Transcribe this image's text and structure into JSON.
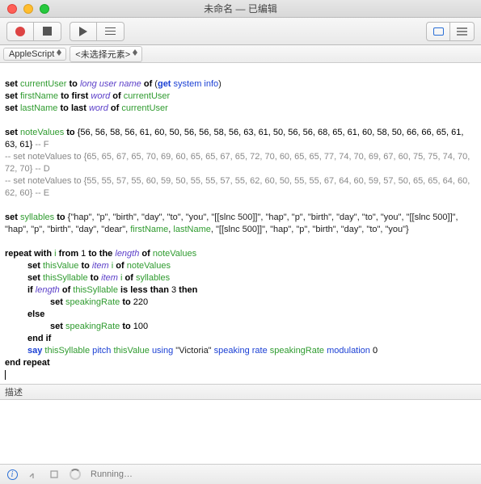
{
  "window": {
    "title": "未命名 — 已编辑"
  },
  "subbar": {
    "language": "AppleScript",
    "nav": "<未选择元素>"
  },
  "code": {
    "l1_set": "set",
    "l1_var": "currentUser",
    "l1_to": "to",
    "l1_prop": "long user name",
    "l1_of": "of",
    "l1_paren_o": "(",
    "l1_call": "get",
    "l1_arg": "system info",
    "l1_paren_c": ")",
    "l2_set": "set",
    "l2_var": "firstName",
    "l2_to": "to",
    "l2_first": "first",
    "l2_word": "word",
    "l2_of": "of",
    "l2_cu": "currentUser",
    "l3_set": "set",
    "l3_var": "lastName",
    "l3_to": "to",
    "l3_last": "last",
    "l3_word": "word",
    "l3_of": "of",
    "l3_cu": "currentUser",
    "nv_set": "set",
    "nv_var": "noteValues",
    "nv_to": "to",
    "nv_list": "{56, 56, 58, 56, 61, 60, 50, 56, 56, 58, 56, 63, 61, 50, 56, 56, 68, 65, 61, 60, 58, 50, 66, 66, 65, 61, 63, 61}",
    "nv_cmt": " -- F",
    "nvD_cmt": "-- set noteValues to {65, 65, 67, 65, 70, 69, 60, 65, 65, 67, 65, 72, 70, 60, 65, 65, 77, 74, 70, 69, 67, 60, 75, 75, 74, 70, 72, 70} -- D",
    "nvE_cmt": "-- set noteValues to {55, 55, 57, 55, 60, 59, 50, 55, 55, 57, 55, 62, 60, 50, 55, 55, 67, 64, 60, 59, 57, 50, 65, 65, 64, 60, 62, 60} -- E",
    "sy_set": "set",
    "sy_var": "syllables",
    "sy_to": "to",
    "sy_p1": "{\"hap\", \"p\", \"birth\", \"day\", \"to\", \"you\", \"[[slnc 500]]\", \"hap\", \"p\", \"birth\", \"day\", \"to\", \"you\", \"[[slnc 500]]\", \"hap\", \"p\", \"birth\", \"day\", \"dear\", ",
    "sy_fn": "firstName",
    "sy_comma1": ", ",
    "sy_ln": "lastName",
    "sy_p2": ", \"[[slnc 500]]\", \"hap\", \"p\", \"birth\", \"day\", \"to\", \"you\"}",
    "rp_repeat": "repeat with",
    "rp_i": "i",
    "rp_from": "from",
    "rp_1": "1",
    "rp_tothe": "to the",
    "rp_len": "length",
    "rp_of": "of",
    "rp_nv": "noteValues",
    "rl1_set": "set",
    "rl1_tv": "thisValue",
    "rl1_to": "to",
    "rl1_item": "item",
    "rl1_i": "i",
    "rl1_of": "of",
    "rl1_nv": "noteValues",
    "rl2_set": "set",
    "rl2_ts": "thisSyllable",
    "rl2_to": "to",
    "rl2_item": "item",
    "rl2_i": "i",
    "rl2_of": "of",
    "rl2_sy": "syllables",
    "rl3_if": "if",
    "rl3_len": "length",
    "rl3_of": "of",
    "rl3_ts": "thisSyllable",
    "rl3_cond": "is less than",
    "rl3_3": "3",
    "rl3_then": "then",
    "rl4_set": "set",
    "rl4_sr": "speakingRate",
    "rl4_to": "to",
    "rl4_220": "220",
    "rl5_else": "else",
    "rl6_set": "set",
    "rl6_sr": "speakingRate",
    "rl6_to": "to",
    "rl6_100": "100",
    "rl7_endif": "end if",
    "rl8_say": "say",
    "rl8_ts": "thisSyllable",
    "rl8_pitch": "pitch",
    "rl8_tv": "thisValue",
    "rl8_using": "using",
    "rl8_vic": "\"Victoria\"",
    "rl8_sr_lbl": "speaking rate",
    "rl8_sr": "speakingRate",
    "rl8_mod": "modulation",
    "rl8_0": "0",
    "rp_end": "end repeat"
  },
  "panels": {
    "desc_label": "描述"
  },
  "status": {
    "info": "i",
    "running": "Running…"
  }
}
